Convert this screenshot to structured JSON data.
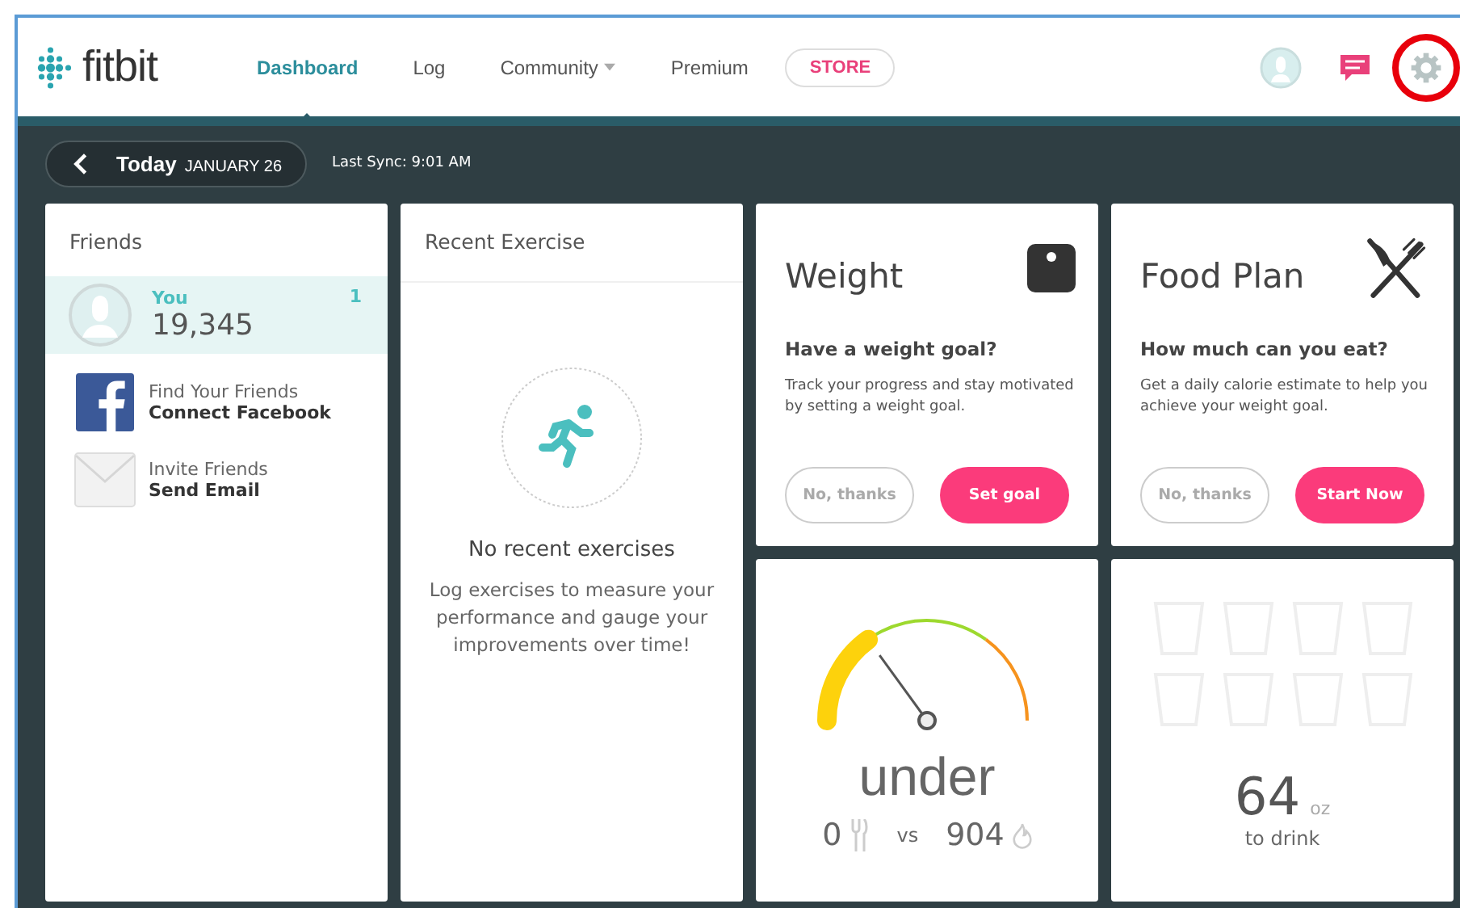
{
  "header": {
    "logo": "fitbit",
    "nav": [
      {
        "label": "Dashboard",
        "selected": true,
        "dropdown": false
      },
      {
        "label": "Log",
        "selected": false,
        "dropdown": false
      },
      {
        "label": "Community",
        "selected": false,
        "dropdown": true
      },
      {
        "label": "Premium",
        "selected": false,
        "dropdown": false
      }
    ],
    "store": "STORE",
    "highlight_settings": true
  },
  "date_bar": {
    "day": "Today",
    "date": "JANUARY 26",
    "sync": "Last Sync: 9:01 AM"
  },
  "friends": {
    "title": "Friends",
    "you": {
      "name": "You",
      "rank": "1",
      "steps": "19,345"
    },
    "actions": [
      {
        "kind": "facebook",
        "line1": "Find Your Friends",
        "line2": "Connect Facebook"
      },
      {
        "kind": "email",
        "line1": "Invite Friends",
        "line2": "Send Email"
      }
    ]
  },
  "exercise": {
    "title": "Recent Exercise",
    "empty_title": "No recent exercises",
    "empty_text": "Log exercises to measure your performance and gauge your improvements over time!"
  },
  "weight": {
    "title": "Weight",
    "question": "Have a weight goal?",
    "text": "Track your progress and stay motivated by setting a weight goal.",
    "buttons": [
      "No, thanks",
      "Set goal"
    ]
  },
  "food_plan": {
    "title": "Food Plan",
    "question": "How much can you eat?",
    "text": "Get a daily calorie estimate to help you achieve your weight goal.",
    "buttons": [
      "No, thanks",
      "Start Now"
    ]
  },
  "calories": {
    "status": "under",
    "eaten": "0",
    "vs": "vs",
    "burned": "904"
  },
  "water": {
    "amount": "64",
    "unit": "oz",
    "label": "to drink"
  }
}
